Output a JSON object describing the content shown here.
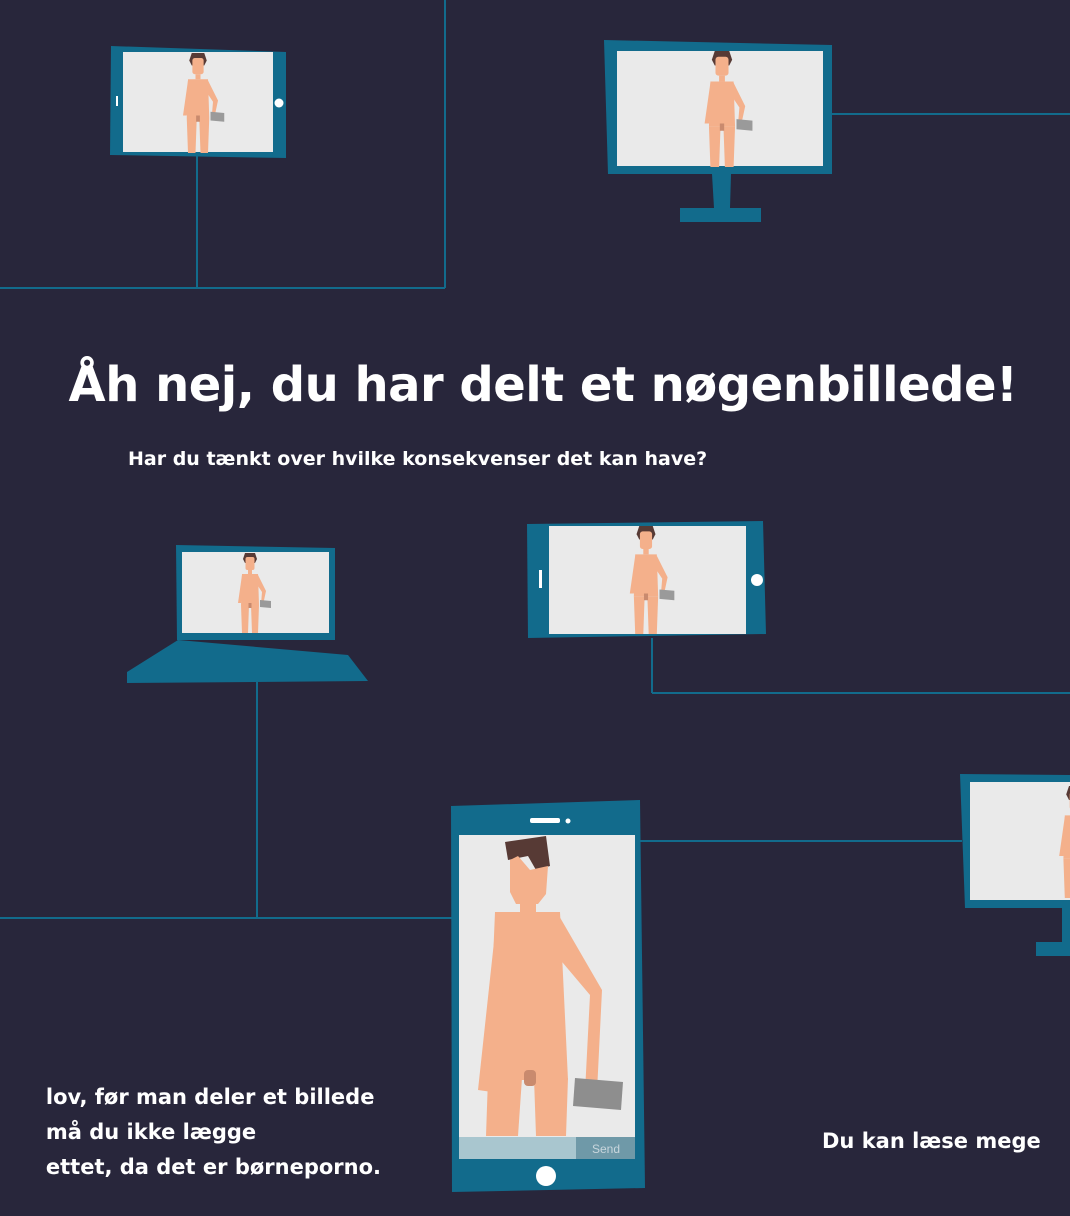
{
  "headline": "Åh nej, du har delt et nøgenbillede!",
  "subheadline": "Har du tænkt over hvilke konsekvenser det kan have?",
  "left_text_lines": [
    "lov, før man deler et billede",
    "må du ikke lægge",
    "ettet, da det er børneporno."
  ],
  "right_text": "Du kan læse mege",
  "phone_send_label": "Send",
  "colors": {
    "background": "#28263b",
    "device": "#126b8c",
    "screen": "#eaeaea",
    "skin": "#f4b08b",
    "hair": "#573a35",
    "text": "#ffffff"
  },
  "devices": [
    {
      "name": "tablet-top-left",
      "icon": "tablet-icon"
    },
    {
      "name": "monitor-top-center",
      "icon": "monitor-icon"
    },
    {
      "name": "laptop-middle-left",
      "icon": "laptop-icon"
    },
    {
      "name": "tablet-middle-center",
      "icon": "tablet-icon"
    },
    {
      "name": "monitor-right-partial",
      "icon": "monitor-icon"
    },
    {
      "name": "phone-main",
      "icon": "smartphone-icon"
    }
  ]
}
